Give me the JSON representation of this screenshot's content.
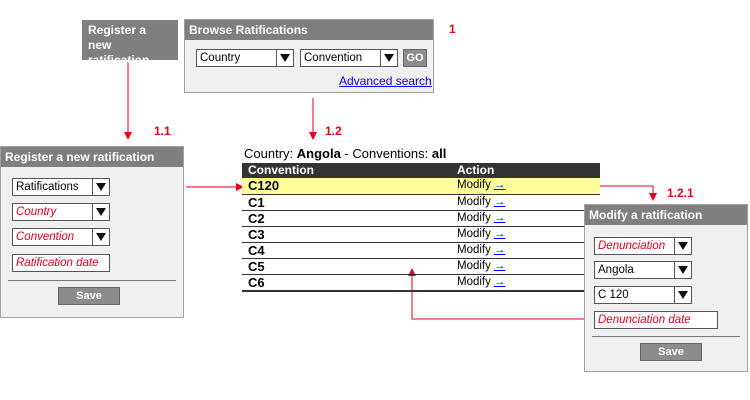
{
  "register_box": {
    "label": "Register a new ratification"
  },
  "browse": {
    "title": "Browse Ratifications",
    "country_select": "Country",
    "convention_select": "Convention",
    "go_label": "GO",
    "advanced_search": "Advanced search"
  },
  "register_panel": {
    "title": "Register a new ratification",
    "type_select": "Ratifications",
    "country_select": "Country",
    "convention_select": "Convention",
    "date_field": "Ratification date",
    "save_label": "Save"
  },
  "list": {
    "country_prefix": "Country: ",
    "country_value": "Angola",
    "conventions_prefix": " - Conventions: ",
    "conventions_value": "all",
    "headers": {
      "convention": "Convention",
      "action": "Action"
    },
    "rows": [
      {
        "convention": "C120",
        "action": "Modify",
        "arrow": "→"
      },
      {
        "convention": "C1",
        "action": "Modify",
        "arrow": "→"
      },
      {
        "convention": "C2",
        "action": "Modify",
        "arrow": "→"
      },
      {
        "convention": "C3",
        "action": "Modify",
        "arrow": "→"
      },
      {
        "convention": "C4",
        "action": "Modify",
        "arrow": "→"
      },
      {
        "convention": "C5",
        "action": "Modify",
        "arrow": "→"
      },
      {
        "convention": "C6",
        "action": "Modify",
        "arrow": "→"
      }
    ]
  },
  "modify_panel": {
    "title": "Modify a ratification",
    "type_select": "Denunciation",
    "country_select": "Angola",
    "convention_select": "C 120",
    "date_field": "Denunciation date",
    "save_label": "Save"
  },
  "step_numbers": {
    "browse": "1",
    "register": "1.1",
    "list": "1.2",
    "modify": "1.2.1"
  },
  "colors": {
    "arrow": "#e3001b",
    "highlight": "#ffff99",
    "panel_title": "#7f7f7f"
  }
}
